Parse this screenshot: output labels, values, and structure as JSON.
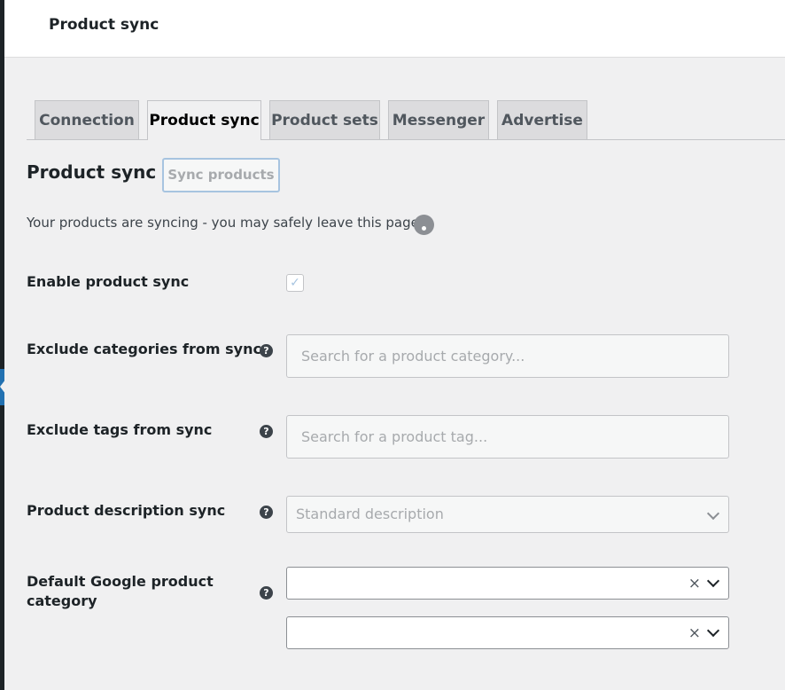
{
  "header": {
    "title": "Product sync"
  },
  "tabs": [
    {
      "label": "Connection",
      "active": false
    },
    {
      "label": "Product sync",
      "active": true
    },
    {
      "label": "Product sets",
      "active": false
    },
    {
      "label": "Messenger",
      "active": false
    },
    {
      "label": "Advertise",
      "active": false
    }
  ],
  "section": {
    "title": "Product sync",
    "sync_button_label": "Sync products",
    "status_text": "Your products are syncing - you may safely leave this page"
  },
  "form": {
    "enable_sync": {
      "label": "Enable product sync",
      "checked": true,
      "check_glyph": "✓"
    },
    "exclude_categories": {
      "label": "Exclude categories from sync",
      "placeholder": "Search for a product category...",
      "value": ""
    },
    "exclude_tags": {
      "label": "Exclude tags from sync",
      "placeholder": "Search for a product tag...",
      "value": ""
    },
    "description_sync": {
      "label": "Product description sync",
      "selected": "Standard description"
    },
    "google_category": {
      "label_line1": "Default Google product",
      "label_line2": "category",
      "clear_glyph": "×"
    },
    "help_glyph": "?"
  },
  "colors": {
    "accent": "#2271b1",
    "button_border": "#a7c4e0",
    "page_background": "#f0f0f1",
    "admin_bar": "#1d2327"
  },
  "icons": {
    "help": "question-circle-icon",
    "spinner": "loading-spinner-icon",
    "chevron": "chevron-down-icon",
    "clear": "clear-icon",
    "check": "checkmark-icon"
  }
}
